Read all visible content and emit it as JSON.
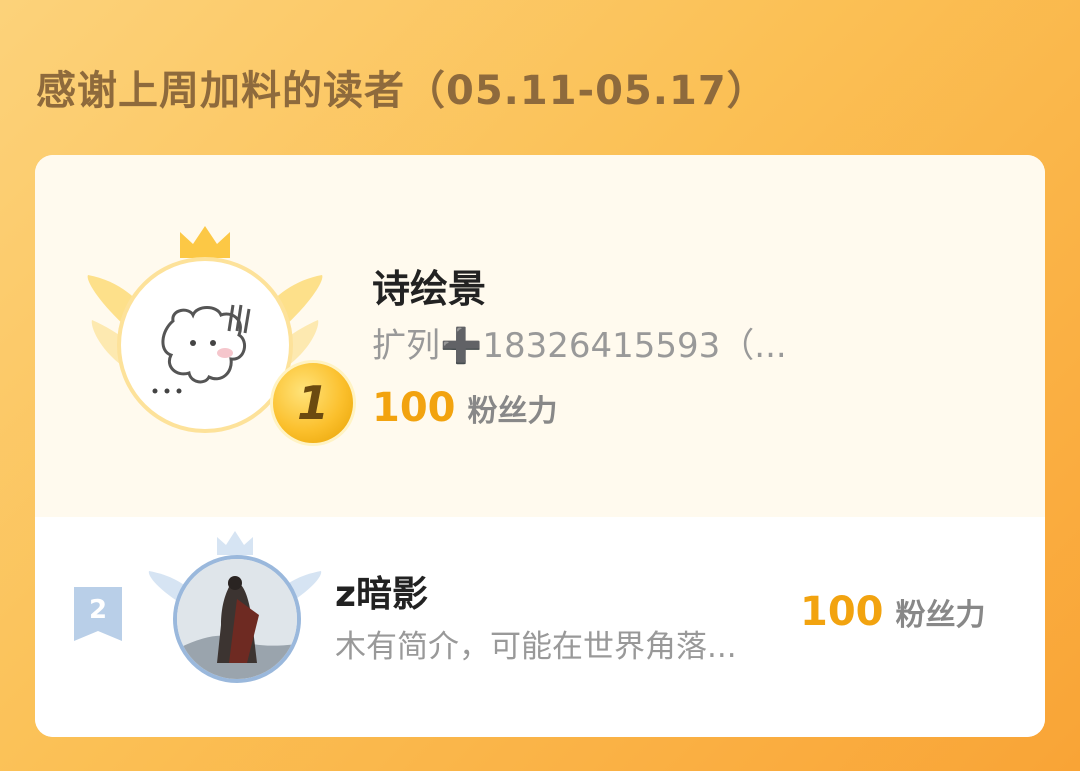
{
  "header": {
    "title": "感谢上周加料的读者（05.11-05.17）"
  },
  "first_place": {
    "rank": "1",
    "name": "诗绘景",
    "intro": "扩列➕18326415593（...",
    "fans_value": "100",
    "fans_unit": "粉丝力",
    "icons": [
      "crown-icon",
      "wings-icon",
      "sketch-avatar"
    ]
  },
  "second_place": {
    "rank": "2",
    "name": "z暗影",
    "intro": "木有简介，可能在世界角落...",
    "fans_value": "100",
    "fans_unit": "粉丝力",
    "icons": [
      "crown-icon",
      "wings-icon",
      "photo-avatar"
    ]
  },
  "colors": {
    "accent": "#f2a30f",
    "title": "#8e6a3c",
    "silver": "#9ab8dc"
  }
}
